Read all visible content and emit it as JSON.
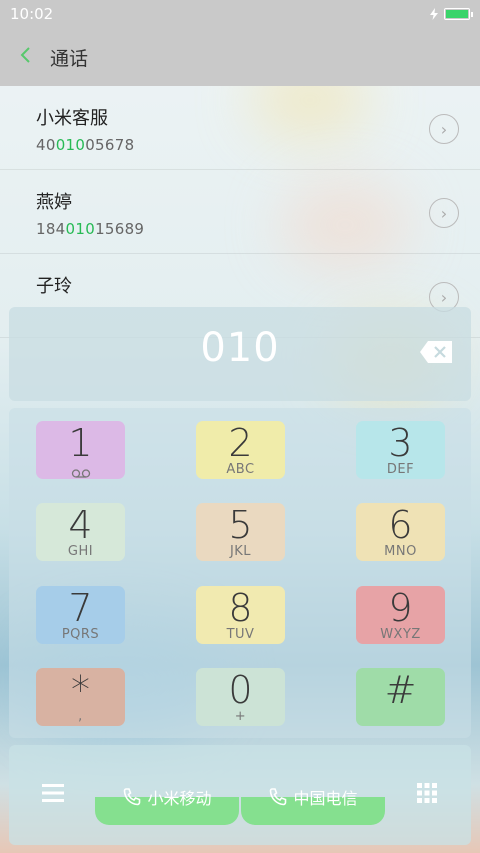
{
  "status_bar": {
    "time": "10:02"
  },
  "header": {
    "title": "通话"
  },
  "contacts": [
    {
      "name": "小米客服",
      "number_pre": "40",
      "number_match": "010",
      "number_post": "05678"
    },
    {
      "name": "燕婷",
      "number_pre": "184",
      "number_match": "010",
      "number_post": "15689"
    },
    {
      "name": "子玲",
      "number_pre": "",
      "number_match": "",
      "number_post": ""
    }
  ],
  "dialer": {
    "input": "010"
  },
  "keys": [
    {
      "digit": "1",
      "letters": "",
      "color": "#dcb9e6"
    },
    {
      "digit": "2",
      "letters": "ABC",
      "color": "#f0ecaa"
    },
    {
      "digit": "3",
      "letters": "DEF",
      "color": "#b7e6ea"
    },
    {
      "digit": "4",
      "letters": "GHI",
      "color": "#d6e8d9"
    },
    {
      "digit": "5",
      "letters": "JKL",
      "color": "#ead9c0"
    },
    {
      "digit": "6",
      "letters": "MNO",
      "color": "#efe2b5"
    },
    {
      "digit": "7",
      "letters": "PQRS",
      "color": "#a6cde9"
    },
    {
      "digit": "8",
      "letters": "TUV",
      "color": "#f1eab0"
    },
    {
      "digit": "9",
      "letters": "WXYZ",
      "color": "#e7a3a6"
    },
    {
      "digit": "*",
      "letters": ",",
      "color": "#d8b2a2"
    },
    {
      "digit": "0",
      "letters": "+",
      "color": "#cce3d6"
    },
    {
      "digit": "#",
      "letters": "",
      "color": "#9fdca8"
    }
  ],
  "call_buttons": [
    {
      "label": "小米移动",
      "sim": "1"
    },
    {
      "label": "中国电信",
      "sim": "2"
    }
  ],
  "colors": {
    "accent": "#27ba55",
    "call_button": "#85e08f"
  }
}
